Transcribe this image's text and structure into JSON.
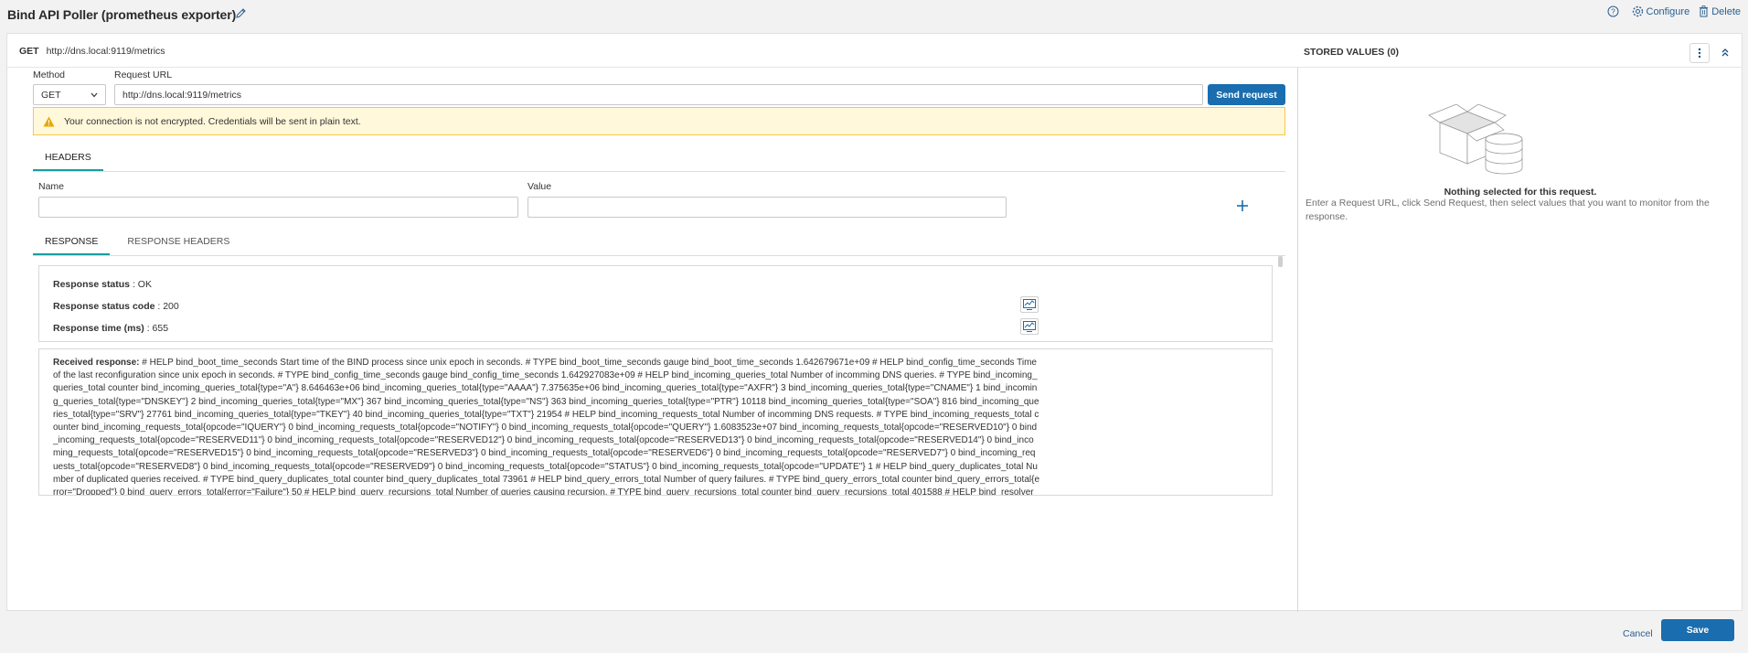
{
  "header": {
    "title": "Bind API Poller (prometheus exporter)",
    "configure_label": "Configure",
    "delete_label": "Delete"
  },
  "request_summary": {
    "method": "GET",
    "url": "http://dns.local:9119/metrics"
  },
  "stored_values": {
    "title": "STORED VALUES (0)",
    "empty_title": "Nothing selected for this request.",
    "empty_desc": "Enter a Request URL, click Send Request, then select values that you want to monitor from the response."
  },
  "form": {
    "method_label": "Method",
    "method_value": "GET",
    "url_label": "Request URL",
    "url_value": "http://dns.local:9119/metrics",
    "send_label": "Send request",
    "warning": "Your connection is not encrypted. Credentials will be sent in plain text."
  },
  "headers_section": {
    "tab_label": "HEADERS",
    "name_label": "Name",
    "value_label": "Value",
    "name_value": "",
    "value_value": ""
  },
  "response_tabs": [
    {
      "label": "RESPONSE",
      "active": true
    },
    {
      "label": "RESPONSE HEADERS",
      "active": false
    }
  ],
  "response": {
    "status_label": "Response status",
    "status_value": "OK",
    "code_label": "Response status code",
    "code_value": "200",
    "time_label": "Response time (ms)",
    "time_value": "655",
    "received_label": "Received response:",
    "received_body": "# HELP bind_boot_time_seconds Start time of the BIND process since unix epoch in seconds. # TYPE bind_boot_time_seconds gauge bind_boot_time_seconds 1.642679671e+09 # HELP bind_config_time_seconds Time of the last reconfiguration since unix epoch in seconds. # TYPE bind_config_time_seconds gauge bind_config_time_seconds 1.642927083e+09 # HELP bind_incoming_queries_total Number of incomming DNS queries. # TYPE bind_incoming_queries_total counter bind_incoming_queries_total{type=\"A\"} 8.646463e+06 bind_incoming_queries_total{type=\"AAAA\"} 7.375635e+06 bind_incoming_queries_total{type=\"AXFR\"} 3 bind_incoming_queries_total{type=\"CNAME\"} 1 bind_incoming_queries_total{type=\"DNSKEY\"} 2 bind_incoming_queries_total{type=\"MX\"} 367 bind_incoming_queries_total{type=\"NS\"} 363 bind_incoming_queries_total{type=\"PTR\"} 10118 bind_incoming_queries_total{type=\"SOA\"} 816 bind_incoming_queries_total{type=\"SRV\"} 27761 bind_incoming_queries_total{type=\"TKEY\"} 40 bind_incoming_queries_total{type=\"TXT\"} 21954 # HELP bind_incoming_requests_total Number of incomming DNS requests. # TYPE bind_incoming_requests_total counter bind_incoming_requests_total{opcode=\"IQUERY\"} 0 bind_incoming_requests_total{opcode=\"NOTIFY\"} 0 bind_incoming_requests_total{opcode=\"QUERY\"} 1.6083523e+07 bind_incoming_requests_total{opcode=\"RESERVED10\"} 0 bind_incoming_requests_total{opcode=\"RESERVED11\"} 0 bind_incoming_requests_total{opcode=\"RESERVED12\"} 0 bind_incoming_requests_total{opcode=\"RESERVED13\"} 0 bind_incoming_requests_total{opcode=\"RESERVED14\"} 0 bind_incoming_requests_total{opcode=\"RESERVED15\"} 0 bind_incoming_requests_total{opcode=\"RESERVED3\"} 0 bind_incoming_requests_total{opcode=\"RESERVED6\"} 0 bind_incoming_requests_total{opcode=\"RESERVED7\"} 0 bind_incoming_requests_total{opcode=\"RESERVED8\"} 0 bind_incoming_requests_total{opcode=\"RESERVED9\"} 0 bind_incoming_requests_total{opcode=\"STATUS\"} 0 bind_incoming_requests_total{opcode=\"UPDATE\"} 1 # HELP bind_query_duplicates_total Number of duplicated queries received. # TYPE bind_query_duplicates_total counter bind_query_duplicates_total 73961 # HELP bind_query_errors_total Number of query failures. # TYPE bind_query_errors_total counter bind_query_errors_total{error=\"Dropped\"} 0 bind_query_errors_total{error=\"Failure\"} 50 # HELP bind_query_recursions_total Number of queries causing recursion. # TYPE bind_query_recursions_total counter bind_query_recursions_total 401588 # HELP bind_resolver_cache_rrsets Number of RRSets in Cache database. # TYPE bind_resolver_cache_rrsets gauge bind_resolver_cache_rrsets{type=\"!AAAA\",view=\"any\"} 3 bind_resolver_cache_rrsets{type=\"!AAAA\",view=\"atl_cvp_exclude\"} 5 bind_resolver_cache_rrsets{type=\"!AAAA\",view=\"corp_internal\"} 4 bind_resolver_cache_rrsets{type=\"A\",view=\"SE_DemoLab\"} 13 bind_resolver_cache_rrsets"
  },
  "footer": {
    "cancel_label": "Cancel",
    "save_label": "Save"
  },
  "colors": {
    "primary": "#1a6dae",
    "link": "#2a5f8f",
    "tab_active": "#1a9e9e",
    "warning_bg": "#fff8db",
    "warning_border": "#f3c94b"
  }
}
